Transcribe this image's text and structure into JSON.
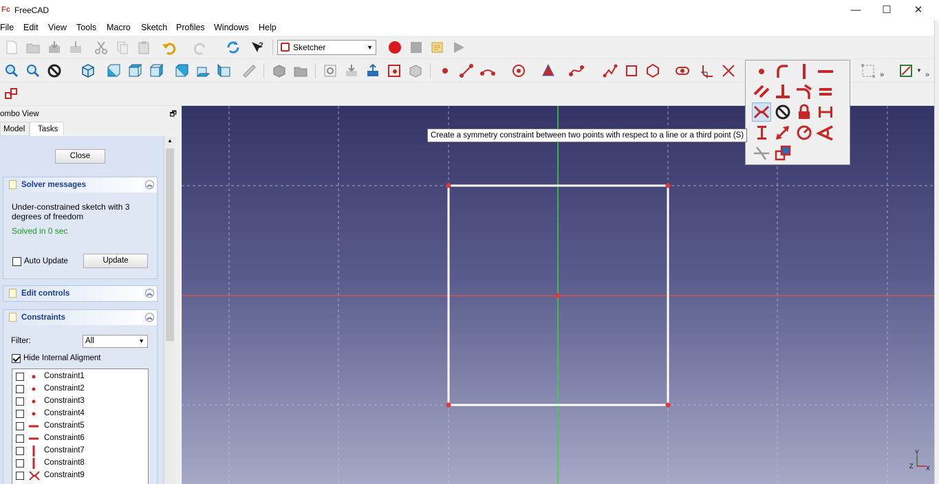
{
  "window": {
    "title": "FreeCAD",
    "logo": "Fc",
    "minimize": "—",
    "maximize": "☐",
    "close": "✕"
  },
  "menu": [
    "File",
    "Edit",
    "View",
    "Tools",
    "Macro",
    "Sketch",
    "Profiles",
    "Windows",
    "Help"
  ],
  "workbench": {
    "selected": "Sketcher"
  },
  "combo_view": {
    "title": "ombo View",
    "tabs": [
      "Model",
      "Tasks"
    ],
    "active_tab": "Tasks",
    "close_button": "Close",
    "solver": {
      "title": "Solver messages",
      "message": "Under-constrained sketch with 3 degrees of freedom",
      "solved": "Solved in 0 sec",
      "auto_update_label": "Auto Update",
      "auto_update_checked": false,
      "update_button": "Update"
    },
    "edit_controls": {
      "title": "Edit controls"
    },
    "constraints": {
      "title": "Constraints",
      "filter_label": "Filter:",
      "filter_value": "All",
      "hide_internal_label": "Hide Internal Aligment",
      "hide_internal_checked": true,
      "items": [
        {
          "name": "Constraint1",
          "icon": "coincident-icon"
        },
        {
          "name": "Constraint2",
          "icon": "coincident-icon"
        },
        {
          "name": "Constraint3",
          "icon": "coincident-icon"
        },
        {
          "name": "Constraint4",
          "icon": "coincident-icon"
        },
        {
          "name": "Constraint5",
          "icon": "horizontal-icon"
        },
        {
          "name": "Constraint6",
          "icon": "horizontal-icon"
        },
        {
          "name": "Constraint7",
          "icon": "vertical-icon"
        },
        {
          "name": "Constraint8",
          "icon": "vertical-icon"
        },
        {
          "name": "Constraint9",
          "icon": "symmetry-icon"
        }
      ]
    }
  },
  "tooltip": "Create a symmetry constraint between two points with respect to a line or a third point (S)",
  "axis_labels": {
    "y": "Y",
    "z": "Z",
    "x": "X"
  },
  "colors": {
    "accent": "#c62828",
    "sketch_line": "#ffffff",
    "vertex": "#e53935",
    "x_axis": "#d9534f",
    "y_axis": "#3fd23f"
  }
}
